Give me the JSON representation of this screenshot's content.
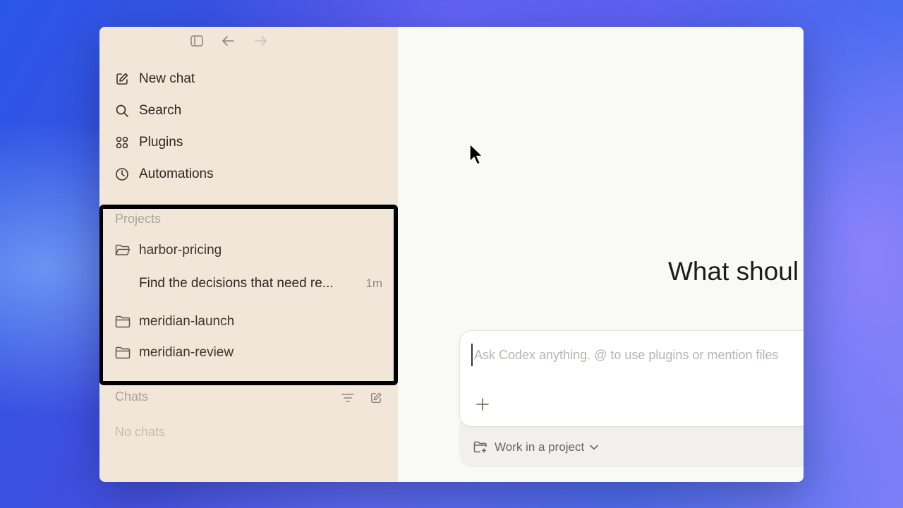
{
  "sidebar": {
    "nav": [
      {
        "label": "New chat",
        "icon": "new-chat-icon"
      },
      {
        "label": "Search",
        "icon": "search-icon"
      },
      {
        "label": "Plugins",
        "icon": "plugins-icon"
      },
      {
        "label": "Automations",
        "icon": "clock-icon"
      }
    ],
    "projects_label": "Projects",
    "projects": [
      {
        "name": "harbor-pricing",
        "icon": "folder-open-icon",
        "threads": [
          {
            "title": "Find the decisions that need re...",
            "age": "1m"
          }
        ]
      },
      {
        "name": "meridian-launch",
        "icon": "folder-icon"
      },
      {
        "name": "meridian-review",
        "icon": "folder-icon"
      }
    ],
    "chats_label": "Chats",
    "chats_empty": "No chats"
  },
  "main": {
    "heading": "What shoul",
    "composer": {
      "placeholder": "Ask Codex anything. @ to use plugins or mention files",
      "project_select": "Work in a project"
    }
  },
  "colors": {
    "sidebar_bg": "#f2e6d8",
    "main_bg": "#f9f9f7",
    "highlight_border": "#000000"
  }
}
